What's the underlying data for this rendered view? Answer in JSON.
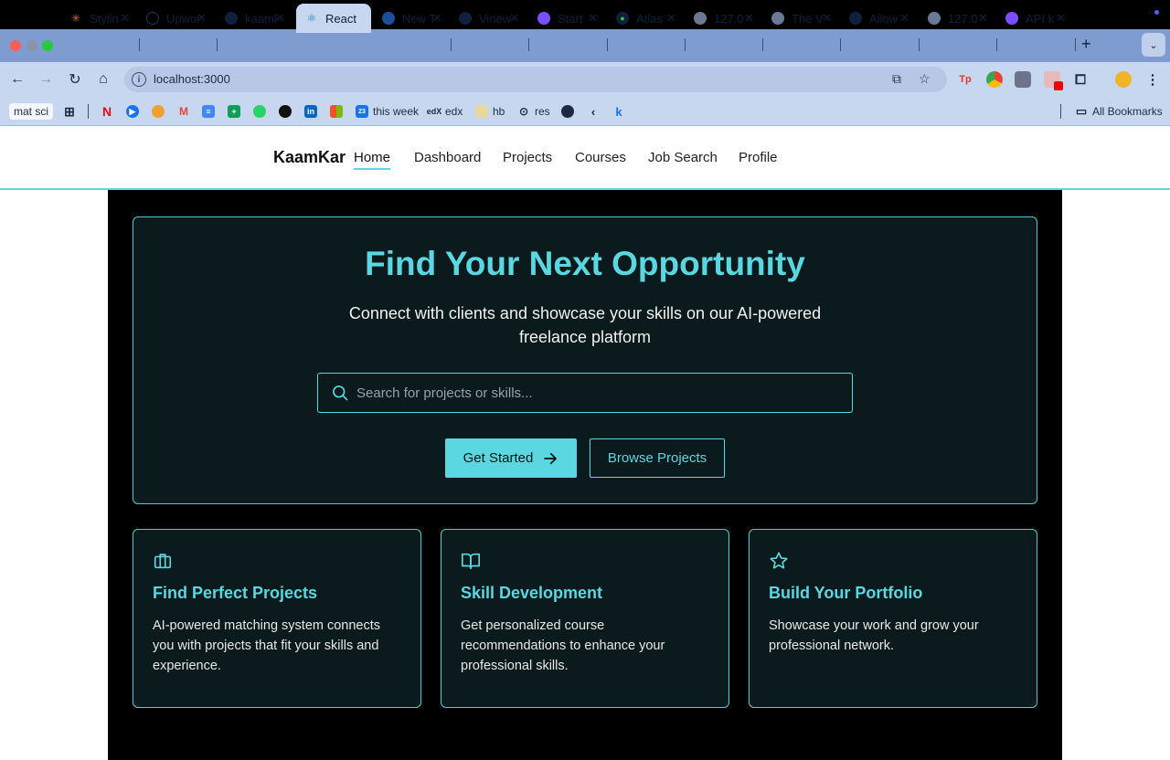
{
  "browser": {
    "tabs": [
      {
        "label": "Stylin",
        "icon": "claude-icon"
      },
      {
        "label": "Upwork",
        "icon": "upwork-icon"
      },
      {
        "label": "kaamkar",
        "icon": "github-icon"
      },
      {
        "label": "React",
        "icon": "react-icon",
        "active": true
      },
      {
        "label": "New Tab",
        "icon": "globe-icon"
      },
      {
        "label": "Vinewood",
        "icon": "github-icon"
      },
      {
        "label": "Start",
        "icon": "purple-icon"
      },
      {
        "label": "Atlas",
        "icon": "mongodb-icon"
      },
      {
        "label": "127.0",
        "icon": "globe-icon"
      },
      {
        "label": "The V",
        "icon": "globe-icon"
      },
      {
        "label": "Allow",
        "icon": "github-icon"
      },
      {
        "label": "127.0",
        "icon": "globe-icon"
      },
      {
        "label": "API k",
        "icon": "purple-icon"
      }
    ],
    "url": "localhost:3000",
    "bookmarks": {
      "chip": "mat sci",
      "items": [
        "this week",
        "edx",
        "hb",
        "res"
      ],
      "all_bookmarks": "All Bookmarks"
    }
  },
  "site": {
    "brand": "KaamKar",
    "nav": [
      "Home",
      "Dashboard",
      "Projects",
      "Courses",
      "Job Search",
      "Profile"
    ],
    "hero": {
      "title": "Find Your Next Opportunity",
      "subtitle": "Connect with clients and showcase your skills on our AI-powered freelance platform",
      "search_placeholder": "Search for projects or skills...",
      "primary_button": "Get Started",
      "secondary_button": "Browse Projects"
    },
    "cards": [
      {
        "icon": "briefcase-icon",
        "title": "Find Perfect Projects",
        "body": "AI-powered matching system connects you with projects that fit your skills and experience."
      },
      {
        "icon": "book-icon",
        "title": "Skill Development",
        "body": "Get personalized course recommendations to enhance your professional skills."
      },
      {
        "icon": "star-icon",
        "title": "Build Your Portfolio",
        "body": "Showcase your work and grow your professional network."
      }
    ],
    "colors": {
      "accent": "#5ad7e0",
      "background": "#000000",
      "panel": "#0b1a1c"
    }
  }
}
